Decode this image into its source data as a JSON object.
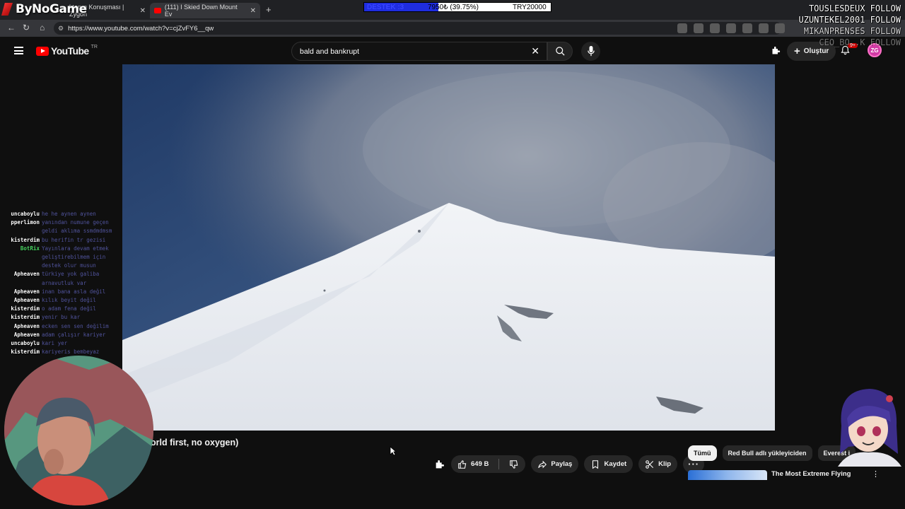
{
  "overlay": {
    "brand": "ByNoGame",
    "donation": {
      "label": "DESTEK :3",
      "amount": "7950₺ (39.75%)",
      "goal": "TRY20000",
      "progress": 0.3975
    },
    "follows": [
      "TOUSLESDEUX FOLLOW",
      "UZUNTEKEL2001 FOLLOW",
      "MIKANPRENSES FOLLOW",
      "CEO_BO..K FOLLOW"
    ],
    "chat": [
      {
        "user": "uncaboylu",
        "msg": "he he aynen aynen"
      },
      {
        "user": "pperlimon",
        "msg": "yanından numune geçen"
      },
      {
        "user": "",
        "msg": "geldi aklıma ssmdmdmsm"
      },
      {
        "user": "kisterdim",
        "msg": "bu herifin tr gezisi"
      },
      {
        "user": "BotRix",
        "msg": "Yayınlara devam etmek"
      },
      {
        "user": "",
        "msg": "geliştirebilmem için"
      },
      {
        "user": "",
        "msg": "destek olur musun"
      },
      {
        "user": "Apheaven",
        "msg": "türkiye yok galiba"
      },
      {
        "user": "",
        "msg": "arnavutluk var"
      },
      {
        "user": "Apheaven",
        "msg": "inan bana asla değil"
      },
      {
        "user": "Apheaven",
        "msg": "kılık beyit değil"
      },
      {
        "user": "kisterdim",
        "msg": "o adam fena değil"
      },
      {
        "user": "kisterdim",
        "msg": "yenir bu kar"
      },
      {
        "user": "Apheaven",
        "msg": "ecken sen sen değilim"
      },
      {
        "user": "Apheaven",
        "msg": "adam çalışır kariyer"
      },
      {
        "user": "uncaboylu",
        "msg": "kari yer"
      },
      {
        "user": "kisterdim",
        "msg": "kariyeris bembeyaz"
      }
    ]
  },
  "browser": {
    "tabs": [
      {
        "title": "ktorun Konuşması | Zygon"
      },
      {
        "title": "(111) I Skied Down Mount Ev"
      }
    ],
    "url": "https://www.youtube.com/watch?v=cjZvFY6__qw"
  },
  "youtube": {
    "logo_text": "YouTube",
    "region": "TR",
    "search_query": "bald and bankrupt",
    "create_label": "Oluştur",
    "notification_count": "9+",
    "avatar_text": "ZG"
  },
  "video": {
    "title_fragment": "orld first, no oxygen)",
    "actions": {
      "like_count": "649 B",
      "share": "Paylaş",
      "save": "Kaydet",
      "clip": "Klip"
    }
  },
  "sidebar": {
    "chips": [
      "Tümü",
      "Red Bull adlı yükleyiciden",
      "Everest i"
    ],
    "rec_title": "The Most Extreme Flying"
  },
  "colors": {
    "yt_red": "#ff0000",
    "donation_fill": "#1f2de0",
    "bg": "#0f0f0f"
  }
}
